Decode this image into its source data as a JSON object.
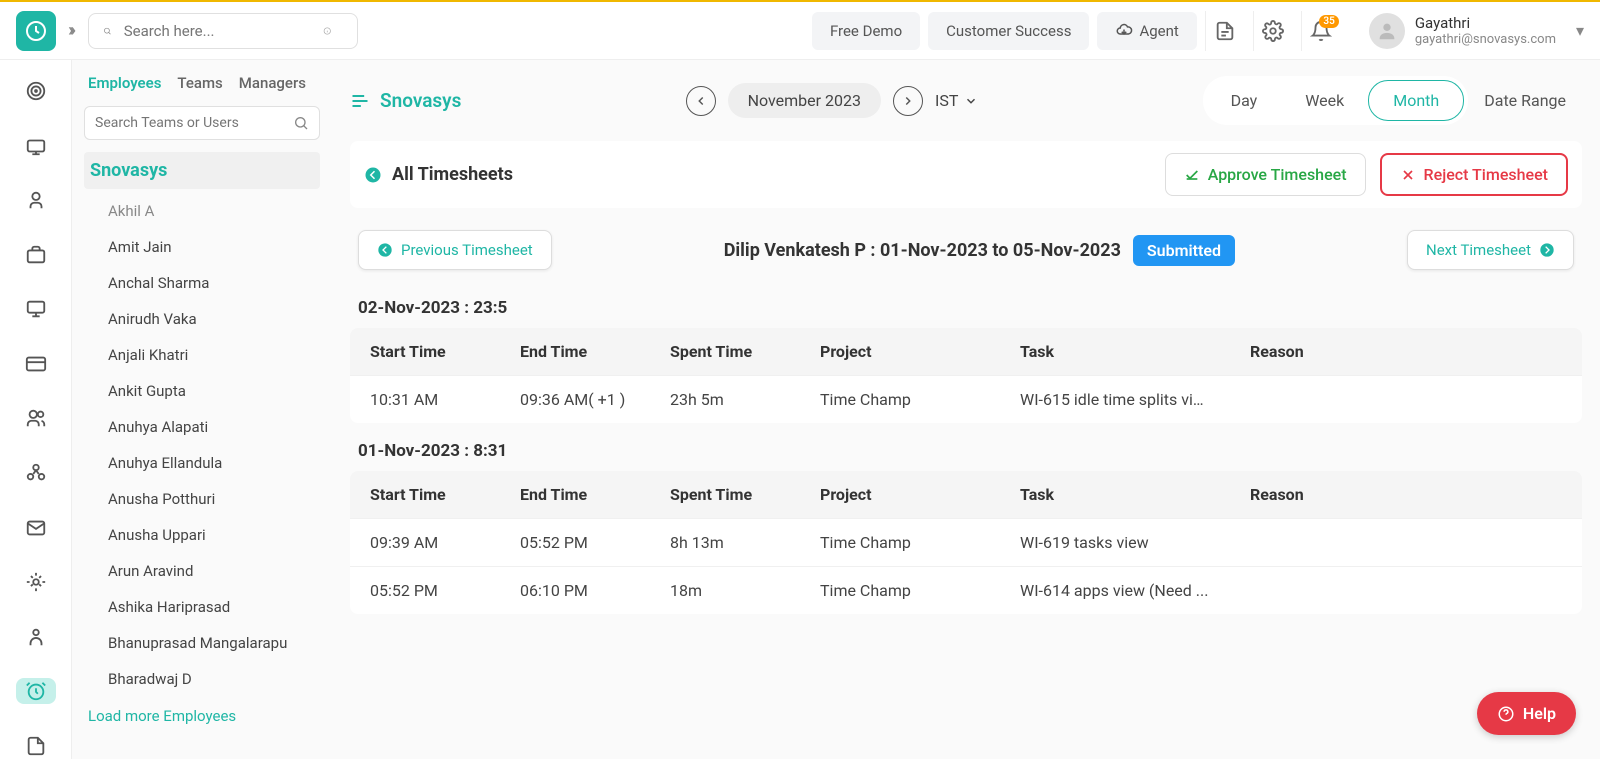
{
  "header": {
    "search_placeholder": "Search here...",
    "free_demo": "Free Demo",
    "customer_success": "Customer Success",
    "agent": "Agent",
    "notification_count": "35",
    "user_name": "Gayathri",
    "user_email": "gayathri@snovasys.com"
  },
  "left_panel": {
    "tabs": {
      "employees": "Employees",
      "teams": "Teams",
      "managers": "Managers"
    },
    "search_placeholder": "Search Teams or Users",
    "org_name": "Snovasys",
    "employees": [
      "Akhil A",
      "Amit Jain",
      "Anchal Sharma",
      "Anirudh Vaka",
      "Anjali Khatri",
      "Ankit Gupta",
      "Anuhya Alapati",
      "Anuhya Ellandula",
      "Anusha Potthuri",
      "Anusha Uppari",
      "Arun Aravind",
      "Ashika Hariprasad",
      "Bhanuprasad Mangalarapu",
      "Bharadwaj D"
    ],
    "load_more": "Load more Employees"
  },
  "main": {
    "org_title": "Snovasys",
    "month_label": "November 2023",
    "timezone": "IST",
    "views": {
      "day": "Day",
      "week": "Week",
      "month": "Month",
      "date_range": "Date Range"
    },
    "back_title": "All Timesheets",
    "approve_label": "Approve Timesheet",
    "reject_label": "Reject Timesheet",
    "prev_label": "Previous Timesheet",
    "next_label": "Next Timesheet",
    "timesheet_title": "Dilip Venkatesh P : 01-Nov-2023 to 05-Nov-2023",
    "status": "Submitted",
    "columns": {
      "start": "Start Time",
      "end": "End Time",
      "spent": "Spent Time",
      "project": "Project",
      "task": "Task",
      "reason": "Reason"
    },
    "days": [
      {
        "header": "02-Nov-2023 : 23:5",
        "rows": [
          {
            "start": "10:31 AM",
            "end": "09:36 AM( +1 )",
            "spent": "23h 5m",
            "project": "Time Champ",
            "task": "WI-615 idle time splits vie...",
            "reason": ""
          }
        ]
      },
      {
        "header": "01-Nov-2023 : 8:31",
        "rows": [
          {
            "start": "09:39 AM",
            "end": "05:52 PM",
            "spent": "8h 13m",
            "project": "Time Champ",
            "task": "WI-619 tasks view",
            "reason": ""
          },
          {
            "start": "05:52 PM",
            "end": "06:10 PM",
            "spent": "18m",
            "project": "Time Champ",
            "task": "WI-614 apps view (Need ...",
            "reason": ""
          }
        ]
      }
    ]
  },
  "help_label": "Help"
}
